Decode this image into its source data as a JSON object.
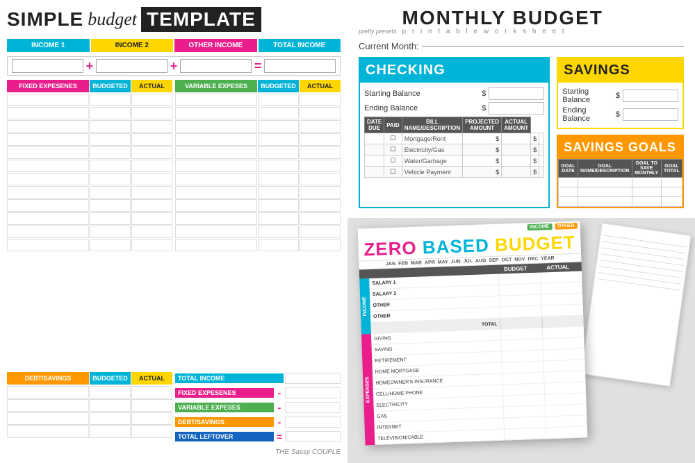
{
  "left": {
    "title": {
      "simple": "SIMPLE",
      "budget": "budget",
      "template": "TEMPLATE"
    },
    "income": {
      "col1": "INCOME 1",
      "col2": "INCOME 2",
      "col3": "OTHER INCOME",
      "col4": "TOTAL INCOME",
      "plus1": "+",
      "plus2": "+",
      "equals": "="
    },
    "expenses": {
      "fixed_label": "FIXED EXPESENES",
      "budgeted": "BUDGETED",
      "actual": "ACTUAL",
      "variable_label": "VARIABLE EXPESES",
      "variable_budgeted": "BUDGETED",
      "variable_actual": "ACTUAL"
    },
    "debt_savings": {
      "label": "DEBT/SAVINGS",
      "budgeted": "BUDGETED",
      "actual": "ACTUAL"
    },
    "summary": {
      "total_income": "TOTAL INCOME",
      "fixed": "FIXED EXPESENES",
      "variable": "VARIABLE EXPESES",
      "debt": "DEBT/SAVINGS",
      "leftover": "TOTAL LEFTOVER",
      "minus": "-",
      "equals": "="
    },
    "attribution": "THE Sassy COUPLE"
  },
  "right": {
    "logo": "pretty\npresets",
    "title": "MONTHLY BUDGET",
    "subtitle": "p r i n t a b l e   w o r k s h e e t",
    "current_month_label": "Current Month:",
    "checking": {
      "header": "CHECKING",
      "starting_label": "Starting Balance",
      "ending_label": "Ending Balance",
      "dollar": "$"
    },
    "savings": {
      "header": "SAVINGS",
      "starting_label": "Starting Balance",
      "ending_label": "Ending Balance",
      "dollar": "$"
    },
    "bills_table": {
      "headers": [
        "DATE DUE",
        "PAID",
        "BILL NAME/DESCRIPTION",
        "PROJECTED AMOUNT",
        "ACTUAL AMOUNT"
      ],
      "rows": [
        {
          "name": "Mortgage/Rent",
          "dollar1": "$",
          "dollar2": "$"
        },
        {
          "name": "Electricity/Gas",
          "dollar1": "$",
          "dollar2": "$"
        },
        {
          "name": "Water/Garbage",
          "dollar1": "$",
          "dollar2": "$"
        },
        {
          "name": "Vehicle Payment",
          "dollar1": "$",
          "dollar2": "$"
        }
      ]
    },
    "savings_goals": {
      "header": "SAVINGS GOALS",
      "headers": [
        "GOAL DATE",
        "GOAL NAME/DESCRIPTION",
        "GOAL TO SAVE MONTHLY",
        "GOAL TOTAL"
      ]
    },
    "zbb": {
      "pills": [
        "INCOME",
        "OTHER"
      ],
      "title_parts": [
        "ZERO ",
        "BASED ",
        "BUDGET"
      ],
      "months": [
        "JAN",
        "FEB",
        "MAR",
        "APR",
        "MAY",
        "JUN",
        "JUL",
        "AUG",
        "SEP",
        "OCT",
        "NOV",
        "DEC",
        "YEAR"
      ],
      "col_headers": [
        "",
        "BUDGET",
        "ACTUAL"
      ],
      "income_rows": [
        "SALARY 1",
        "SALARY 2",
        "OTHER",
        "OTHER"
      ],
      "income_total": "TOTAL",
      "expense_rows": [
        "GIVING",
        "SAVING",
        "RETIREMENT",
        "HOME MORTGAGE",
        "HOMEOWNER'S INSURANCE",
        "CELL/HOME PHONE",
        "ELECTRICITY",
        "GAS",
        "INTERNET",
        "TELEVISION/CABLE"
      ],
      "income_section_label": "INCOME",
      "expense_section_label": "EXPENSES"
    }
  }
}
